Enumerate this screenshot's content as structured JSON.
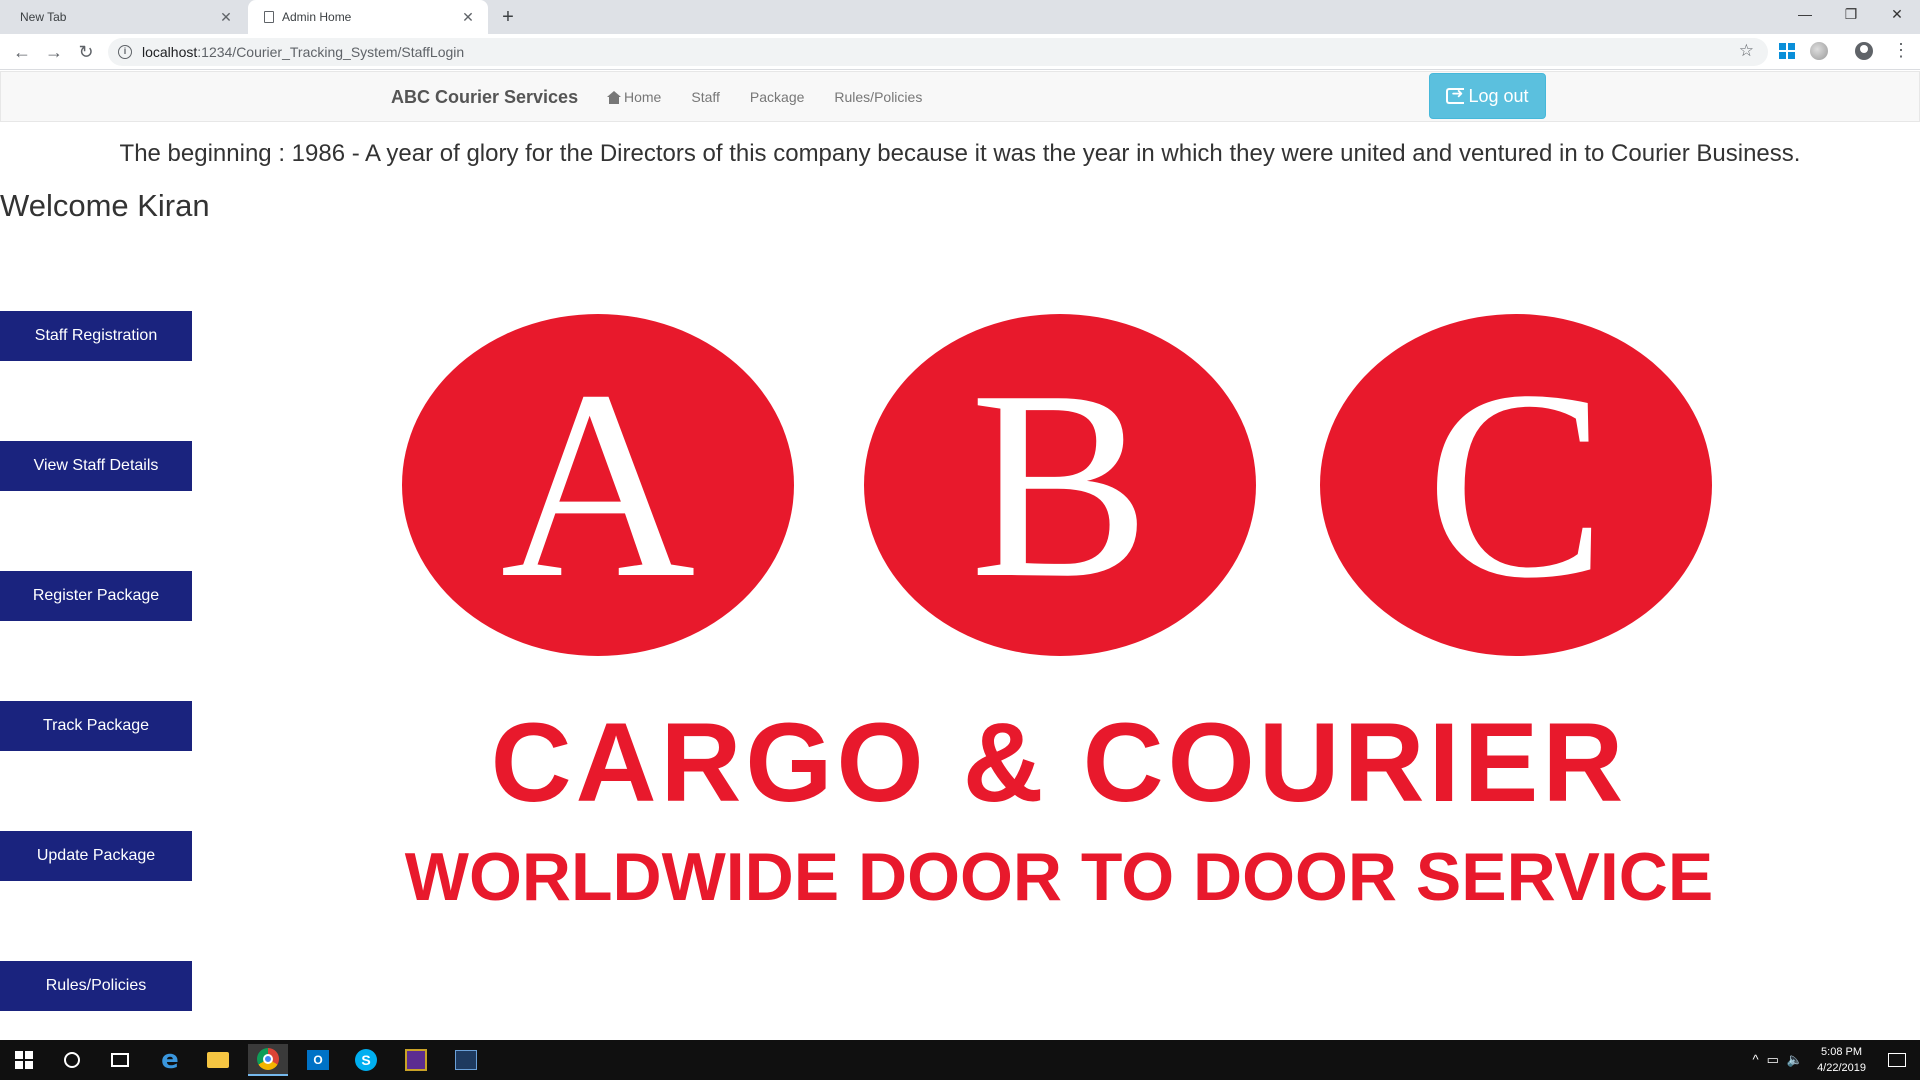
{
  "browser": {
    "tabs": [
      {
        "title": "New Tab",
        "active": false
      },
      {
        "title": "Admin Home",
        "active": true
      }
    ],
    "url_host": "localhost",
    "url_path": ":1234/Courier_Tracking_System/StaffLogin"
  },
  "navbar": {
    "brand": "ABC Courier Services",
    "links": [
      "Home",
      "Staff",
      "Package",
      "Rules/Policies"
    ],
    "logout_label": "Log out"
  },
  "tagline": "The beginning : 1986 - A year of glory for the Directors of this company because it was the year in which they were united and ventured in to Courier Business.",
  "welcome": "Welcome Kiran",
  "sidebar": {
    "buttons": [
      "Staff Registration",
      "View Staff Details",
      "Register Package",
      "Track Package",
      "Update Package",
      "Rules/Policies"
    ]
  },
  "logo": {
    "letters": [
      "A",
      "B",
      "C"
    ],
    "line1": "CARGO & COURIER",
    "line2": "WORLDWIDE DOOR TO DOOR SERVICE",
    "color": "#e8192c"
  },
  "taskbar": {
    "time": "5:08 PM",
    "date": "4/22/2019"
  }
}
